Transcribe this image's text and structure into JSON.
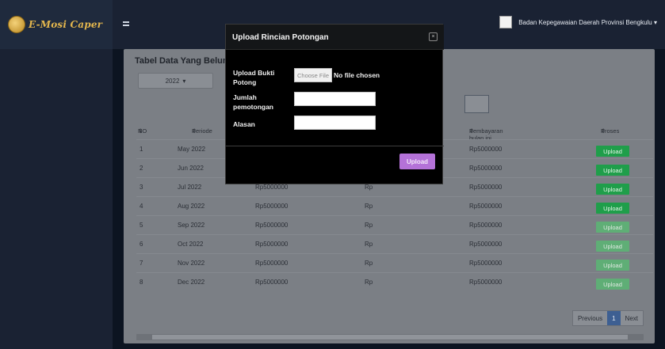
{
  "app": {
    "logo_text": "E-Mosi Caper"
  },
  "header": {
    "user_name": "Badan Kepegawaian Daerah Provinsi Bengkulu",
    "user_caret": "▾"
  },
  "card": {
    "title": "Tabel Data Yang Belum D",
    "year": {
      "selected": "2022",
      "caret": "▾"
    }
  },
  "table": {
    "headers": {
      "no": "NO",
      "periode": "Periode",
      "pembayaran": "Pembayaran bulan ini",
      "proses": "Proses"
    },
    "sort_symbol": "⇕",
    "rows": [
      {
        "no": "1",
        "periode": "May 2022",
        "nominal": "",
        "rp": "",
        "pembayaran": "Rp5000000",
        "action": "Upload"
      },
      {
        "no": "2",
        "periode": "Jun 2022",
        "nominal": "",
        "rp": "",
        "pembayaran": "Rp5000000",
        "action": "Upload"
      },
      {
        "no": "3",
        "periode": "Jul 2022",
        "nominal": "Rp5000000",
        "rp": "Rp",
        "pembayaran": "Rp5000000",
        "action": "Upload"
      },
      {
        "no": "4",
        "periode": "Aug 2022",
        "nominal": "Rp5000000",
        "rp": "Rp",
        "pembayaran": "Rp5000000",
        "action": "Upload"
      },
      {
        "no": "5",
        "periode": "Sep 2022",
        "nominal": "Rp5000000",
        "rp": "Rp",
        "pembayaran": "Rp5000000",
        "action": "Upload"
      },
      {
        "no": "6",
        "periode": "Oct 2022",
        "nominal": "Rp5000000",
        "rp": "Rp",
        "pembayaran": "Rp5000000",
        "action": "Upload"
      },
      {
        "no": "7",
        "periode": "Nov 2022",
        "nominal": "Rp5000000",
        "rp": "Rp",
        "pembayaran": "Rp5000000",
        "action": "Upload"
      },
      {
        "no": "8",
        "periode": "Dec 2022",
        "nominal": "Rp5000000",
        "rp": "Rp",
        "pembayaran": "Rp5000000",
        "action": "Upload"
      }
    ]
  },
  "pagination": {
    "previous": "Previous",
    "current": "1",
    "next": "Next"
  },
  "modal": {
    "title": "Upload Rincian Potongan",
    "close_glyph": "×",
    "file_label": "Upload Bukti Potong",
    "file_button": "Choose File",
    "file_status": "No file chosen",
    "jumlah_label": "Jumlah pemotongan",
    "jumlah_value": "",
    "alasan_label": "Alasan",
    "alasan_value": "",
    "submit_label": "Upload"
  },
  "colors": {
    "upload_button": "#1f9e4a",
    "modal_submit": "#b472d8",
    "pagination_active": "#3d5f92"
  },
  "icons": [
    "menu-icon",
    "close-icon",
    "sort-icon",
    "caret-down-icon"
  ]
}
